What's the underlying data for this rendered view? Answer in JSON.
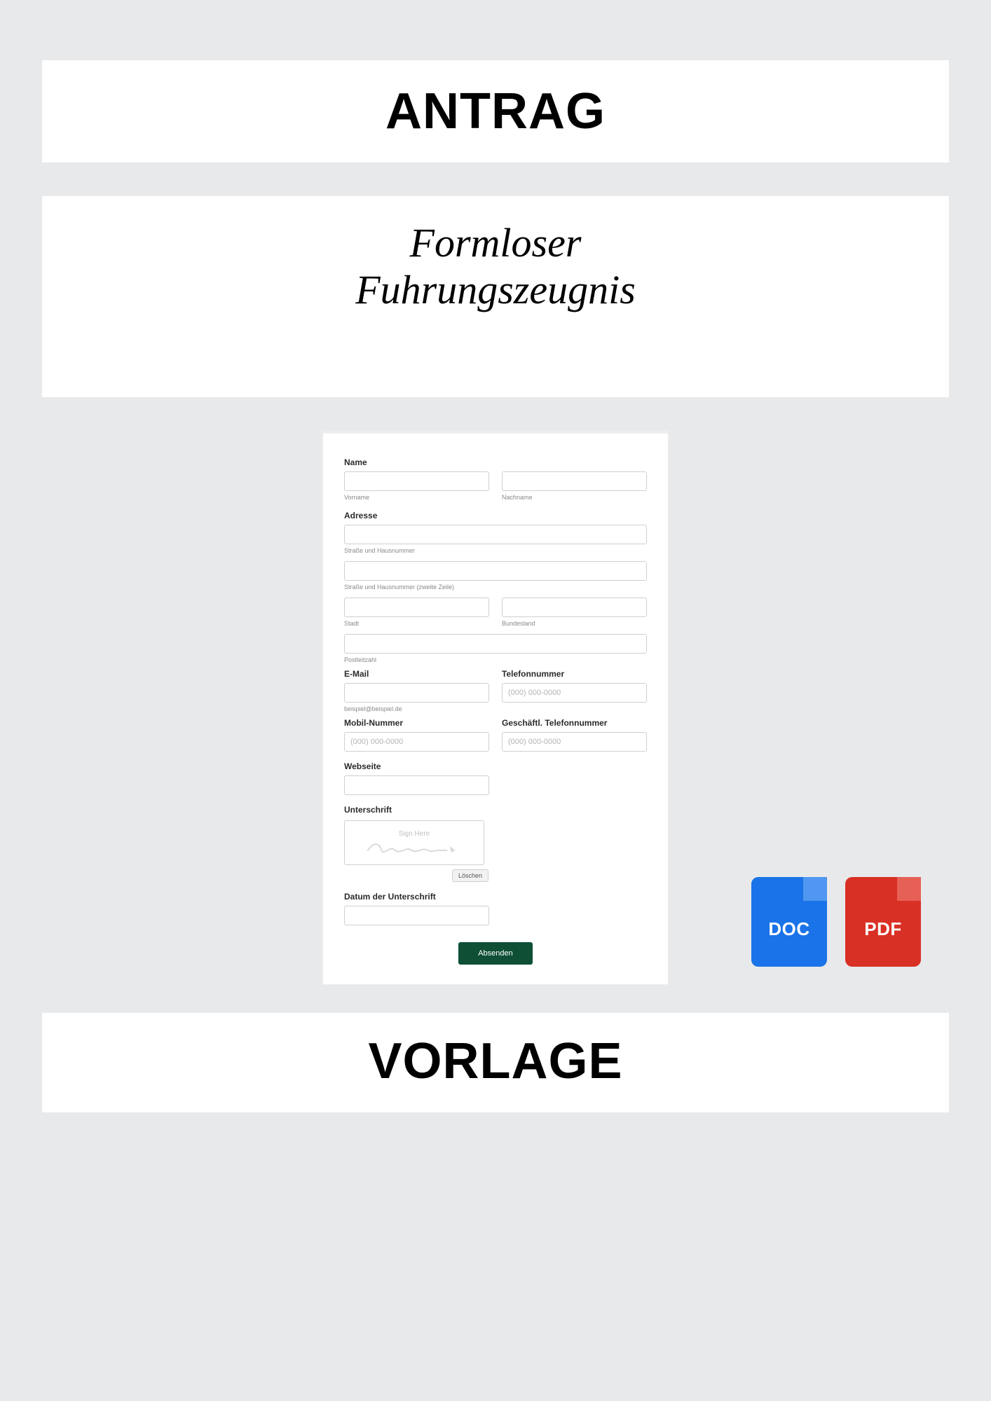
{
  "header": {
    "title": "ANTRAG"
  },
  "subtitle": {
    "line1": "Formloser",
    "line2": "Fuhrungszeugnis"
  },
  "form": {
    "name": {
      "label": "Name",
      "vorname_sub": "Vorname",
      "nachname_sub": "Nachname"
    },
    "adresse": {
      "label": "Adresse",
      "street_sub": "Straße und Hausnummer",
      "street2_sub": "Straße und Hausnummer (zweite Zeile)",
      "city_sub": "Stadt",
      "state_sub": "Bundesland",
      "zip_sub": "Postleitzahl"
    },
    "email": {
      "label": "E-Mail",
      "sub": "beispiel@beispiel.de"
    },
    "phone": {
      "label": "Telefonnummer",
      "placeholder": "(000) 000-0000"
    },
    "mobile": {
      "label": "Mobil-Nummer",
      "placeholder": "(000) 000-0000"
    },
    "workphone": {
      "label": "Geschäftl. Telefonnummer",
      "placeholder": "(000) 000-0000"
    },
    "website": {
      "label": "Webseite"
    },
    "signature": {
      "label": "Unterschrift",
      "sign_here": "Sign Here",
      "clear": "Löschen"
    },
    "sigdate": {
      "label": "Datum der Unterschrift"
    },
    "submit": "Absenden"
  },
  "icons": {
    "doc": "DOC",
    "pdf": "PDF"
  },
  "footer": {
    "title": "VORLAGE"
  }
}
